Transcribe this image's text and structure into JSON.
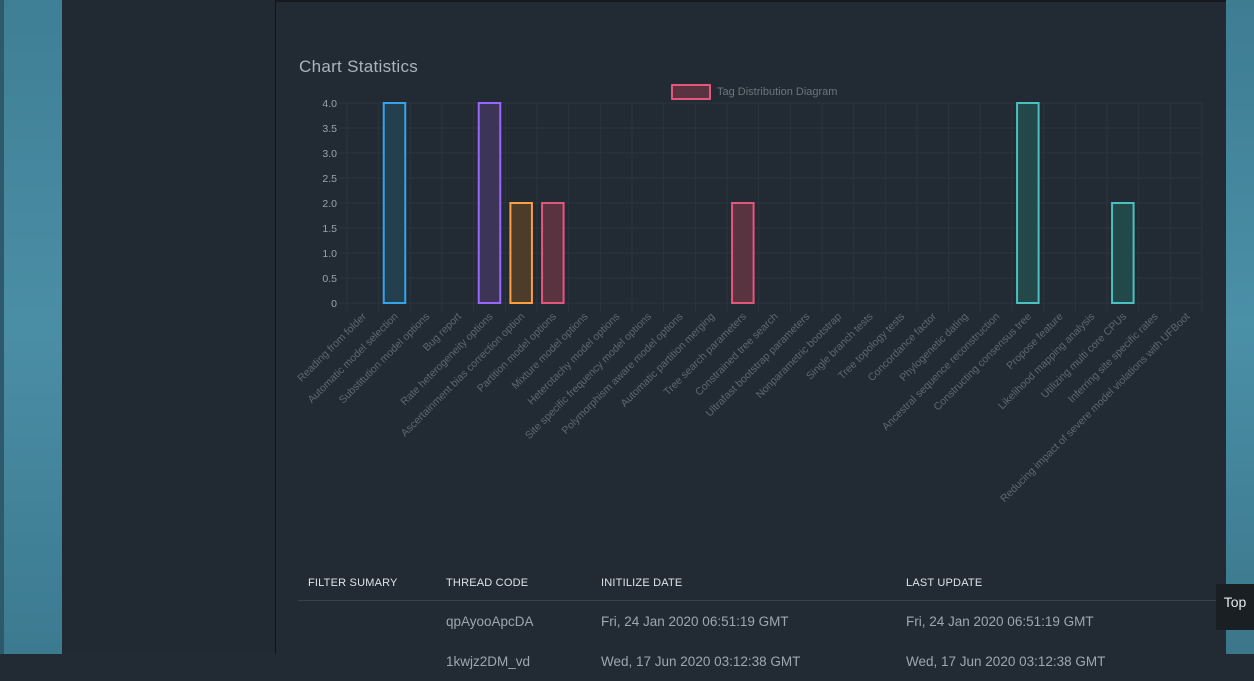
{
  "section_title": "Chart Statistics",
  "top_button_label": "Top",
  "chart_data": {
    "type": "bar",
    "legend": [
      "Tag Distribution Diagram"
    ],
    "legend_position": "top-center",
    "grid": true,
    "ylim": [
      0,
      4
    ],
    "yticks": [
      "0",
      "0.5",
      "1.0",
      "1.5",
      "2.0",
      "2.5",
      "3.0",
      "3.5",
      "4.0"
    ],
    "categories": [
      "Reading from folder",
      "Automatic model selection",
      "Substitution model options",
      "Bug report",
      "Rate heterogeneity options",
      "Ascertainment bias correction option",
      "Partition model options",
      "Mixture model options",
      "Heterotachy model options",
      "Site specific frequency model options",
      "Polymorphism aware model options",
      "Automatic partition merging",
      "Tree search parameters",
      "Constrained tree search",
      "Ultrafast bootstrap parameters",
      "Nonparametric bootstrap",
      "Single branch tests",
      "Tree topology tests",
      "Concordance factor",
      "Phylogenetic dating",
      "Ancestral sequence reconstruction",
      "Constructing consensus tree",
      "Propose feature",
      "Likelihood mapping analysis",
      "Utilizing multi core CPUs",
      "Inferring site specific rates",
      "Reducing impact of severe model violations with UFBoot"
    ],
    "series": [
      {
        "name": "Tag Distribution Diagram",
        "values": [
          0,
          4,
          0,
          0,
          4,
          2,
          2,
          0,
          0,
          0,
          0,
          0,
          2,
          0,
          0,
          0,
          0,
          0,
          0,
          0,
          0,
          4,
          0,
          0,
          2,
          0,
          0
        ]
      }
    ],
    "bar_colors": {
      "1": {
        "stroke": "#36a2eb",
        "fill": "#24404f"
      },
      "4": {
        "stroke": "#9966ff",
        "fill": "#3c3558"
      },
      "5": {
        "stroke": "#ff9f40",
        "fill": "#4d3c2a"
      },
      "6": {
        "stroke": "#e3577a",
        "fill": "#5a3340"
      },
      "12": {
        "stroke": "#e3577a",
        "fill": "#5a3340"
      },
      "21": {
        "stroke": "#4bc0c0",
        "fill": "#224849"
      },
      "24": {
        "stroke": "#4bc0c0",
        "fill": "#224849"
      }
    }
  },
  "table": {
    "headers": [
      "FILTER SUMARY",
      "THREAD CODE",
      "INITILIZE DATE",
      "LAST UPDATE"
    ],
    "rows": [
      [
        "",
        "qpAyooApcDA",
        "Fri, 24 Jan 2020 06:51:19 GMT",
        "Fri, 24 Jan 2020 06:51:19 GMT"
      ],
      [
        "",
        "1kwjz2DM_vd",
        "Wed, 17 Jun 2020 03:12:38 GMT",
        "Wed, 17 Jun 2020 03:12:38 GMT"
      ]
    ]
  }
}
